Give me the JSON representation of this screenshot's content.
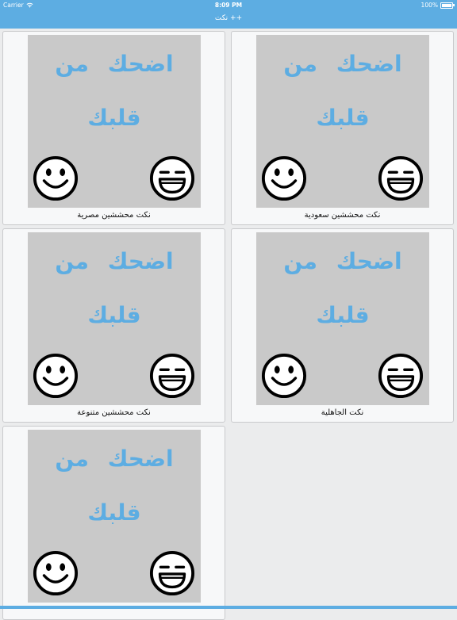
{
  "status": {
    "carrier": "Carrier",
    "time": "8:09 PM",
    "battery": "100%"
  },
  "nav": {
    "title": "نكت ++"
  },
  "thumbnail": {
    "line1": "اضحك من",
    "line2": "قلبك"
  },
  "colors": {
    "accent": "#5dade2",
    "thumb_bg": "#c9c9c9",
    "card_bg": "#f7f8f9"
  },
  "cards": [
    {
      "caption": "نكت محششين سعودية"
    },
    {
      "caption": "نكت محششين مصرية"
    },
    {
      "caption": "نكت الجاهلية"
    },
    {
      "caption": "نكت محششين متنوعة"
    },
    {
      "caption": ""
    }
  ]
}
